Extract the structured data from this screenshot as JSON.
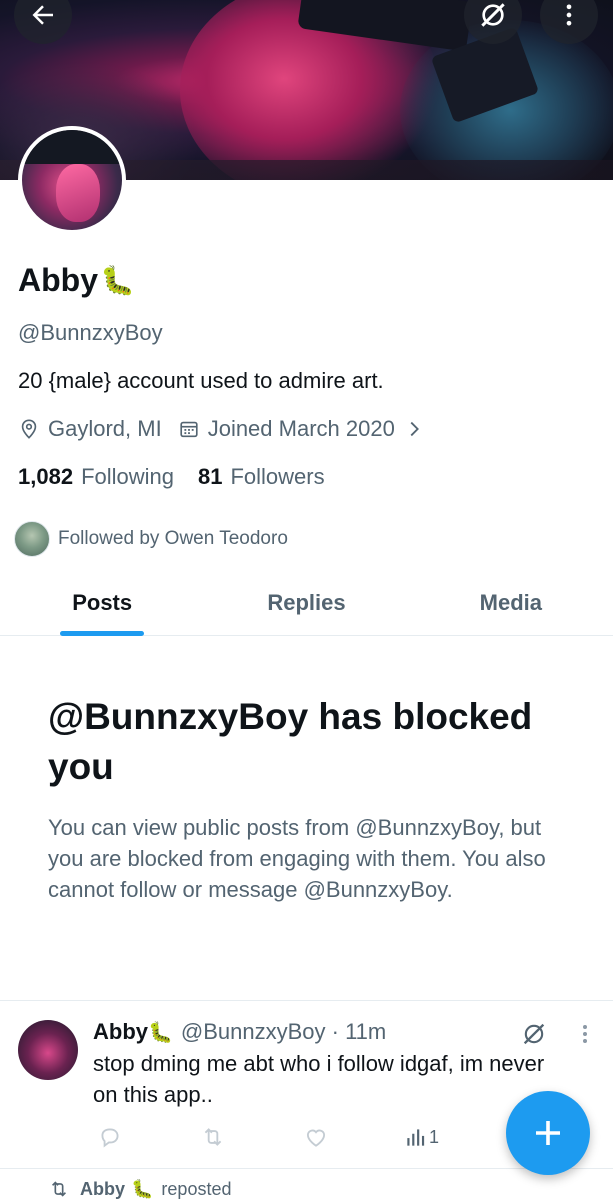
{
  "profile": {
    "name": "Abby",
    "name_emoji": "🐛",
    "handle": "@BunnzxyBoy",
    "bio": "20 {male} account used to admire art.",
    "location": "Gaylord, MI",
    "joined": "Joined March 2020",
    "following_count": "1,082",
    "following_label": "Following",
    "followers_count": "81",
    "followers_label": "Followers",
    "followed_by": "Followed by Owen Teodoro"
  },
  "tabs": [
    {
      "label": "Posts",
      "active": true
    },
    {
      "label": "Replies",
      "active": false
    },
    {
      "label": "Media",
      "active": false
    }
  ],
  "blocked": {
    "title": "@BunnzxyBoy has blocked you",
    "body": "You can view public posts from @BunnzxyBoy, but you are blocked from engaging with them. You also cannot follow or message @BunnzxyBoy."
  },
  "post": {
    "name": "Abby",
    "name_emoji": "🐛",
    "handle_time": "@BunnzxyBoy · 11m",
    "text": "stop dming me abt who i follow idgaf, im never on this app..",
    "views": "1"
  },
  "next_post": {
    "name": "Abby",
    "name_emoji": "🐛",
    "label": "reposted"
  },
  "colors": {
    "accent": "#1d9bf0",
    "text_primary": "#0f1419",
    "text_secondary": "#536471",
    "divider": "#e6ecf0"
  },
  "icons": {
    "back": "arrow-left-icon",
    "grok": "grok-icon",
    "more": "more-vertical-icon",
    "location": "location-pin-icon",
    "calendar": "calendar-icon",
    "chevron": "chevron-right-icon",
    "reply": "reply-icon",
    "repost": "repost-icon",
    "like": "heart-icon",
    "views": "views-icon",
    "compose": "plus-icon"
  }
}
